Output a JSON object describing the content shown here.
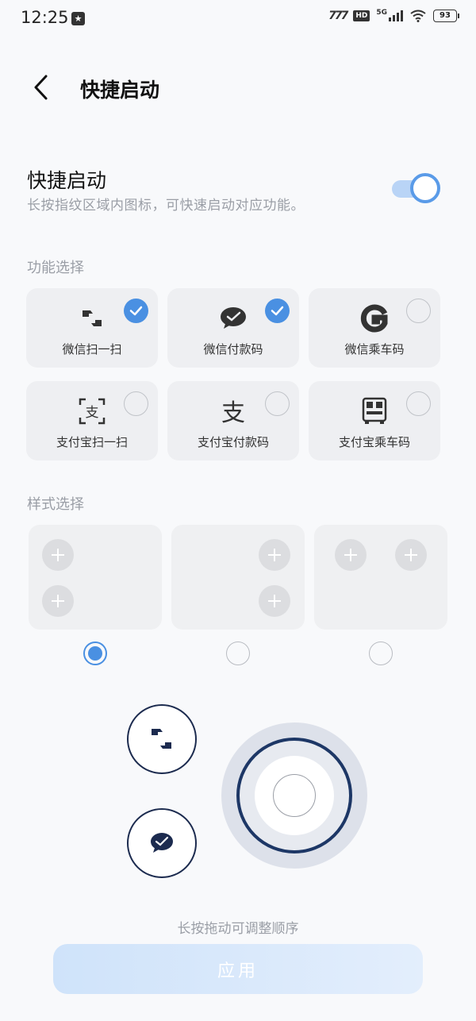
{
  "status_bar": {
    "time": "12:25",
    "network": "5G",
    "hd": "HD",
    "carrier": "777",
    "battery": "93"
  },
  "header": {
    "title": "快捷启动",
    "back_icon": "chevron-left-icon"
  },
  "master": {
    "title": "快捷启动",
    "description": "长按指纹区域内图标，可快速启动对应功能。",
    "enabled": true
  },
  "functions": {
    "label": "功能选择",
    "items": [
      {
        "label": "微信扫一扫",
        "icon": "wechat-scan-icon",
        "checked": true
      },
      {
        "label": "微信付款码",
        "icon": "wechat-pay-icon",
        "checked": true
      },
      {
        "label": "微信乘车码",
        "icon": "wechat-transit-icon",
        "checked": false
      },
      {
        "label": "支付宝扫一扫",
        "icon": "alipay-scan-icon",
        "checked": false
      },
      {
        "label": "支付宝付款码",
        "icon": "alipay-pay-icon",
        "checked": false
      },
      {
        "label": "支付宝乘车码",
        "icon": "alipay-transit-icon",
        "checked": false
      }
    ]
  },
  "styles": {
    "label": "样式选择",
    "selected_index": 0
  },
  "hint": "长按拖动可调整顺序",
  "apply_label": "应用",
  "colors": {
    "accent": "#4a90e2",
    "preview_dark": "#1c2b4f",
    "card_bg": "#eeeff2"
  }
}
